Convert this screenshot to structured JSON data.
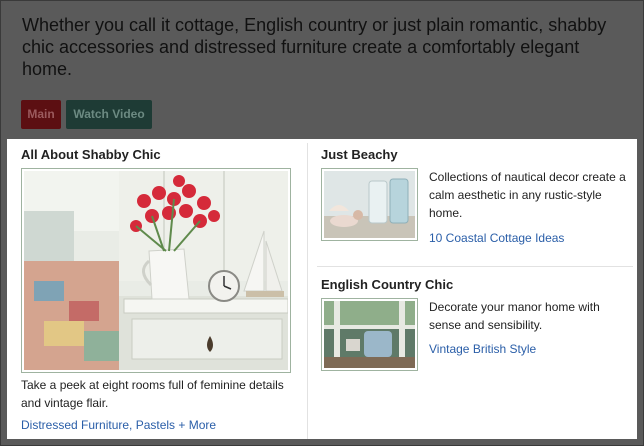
{
  "header": {
    "text": "Whether you call it cottage, English country or just plain romantic, shabby chic accessories and distressed furniture create a comfortably elegant home."
  },
  "buttons": {
    "main": "Main",
    "watch_video": "Watch Video"
  },
  "feature": {
    "title": "All About Shabby Chic",
    "description": "Take a peek at eight rooms full of feminine details and vintage flair.",
    "link": "Distressed Furniture, Pastels + More"
  },
  "cards": [
    {
      "title": "Just Beachy",
      "description": "Collections of nautical decor create a calm aesthetic in any rustic-style home.",
      "link": "10 Coastal Cottage Ideas"
    },
    {
      "title": "English Country Chic",
      "description": "Decorate your manor home with sense and sensibility.",
      "link": "Vintage British Style"
    }
  ],
  "colors": {
    "link": "#2a5ea8",
    "main_button": "#5c0f12",
    "video_button": "#1e3b35"
  }
}
